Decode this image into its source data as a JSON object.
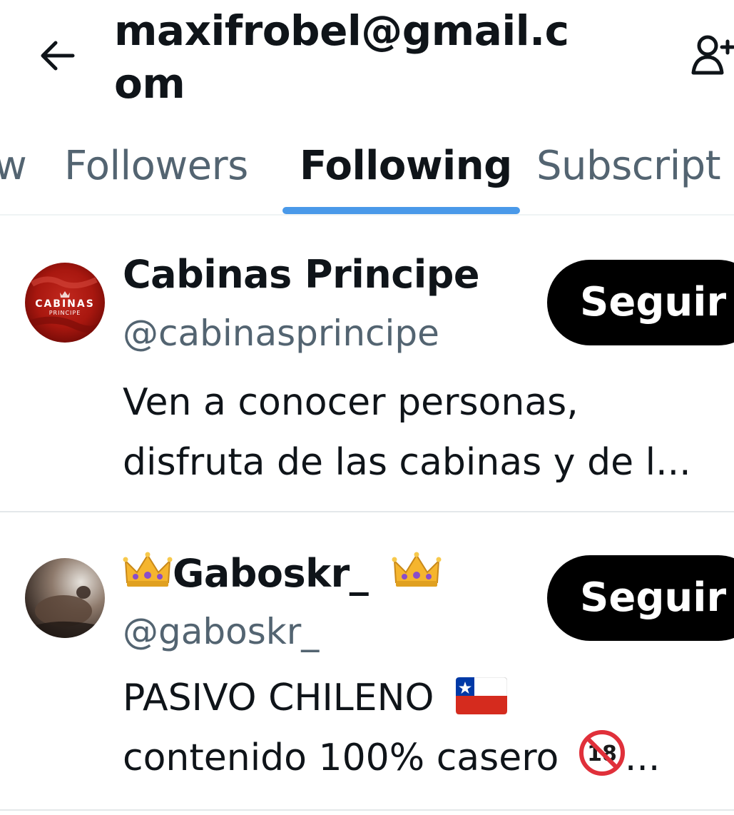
{
  "header": {
    "title": "maxifrobel@gmail.com"
  },
  "tabs": [
    {
      "label": "w",
      "active": false
    },
    {
      "label": "Followers",
      "active": false
    },
    {
      "label": "Following",
      "active": true
    },
    {
      "label": "Subscript",
      "active": false
    }
  ],
  "users": [
    {
      "name": "Cabinas Principe",
      "handle": "@cabinasprincipe",
      "bio_line1": "Ven a conocer personas,",
      "bio_line2": "disfruta de las cabinas y de l...",
      "follow_label": "Seguir",
      "avatar_text": "CABINAS",
      "avatar_subtext": "PRINCIPE"
    },
    {
      "name": "Gaboskr_",
      "name_emoji": "crown",
      "handle": "@gaboskr_",
      "bio_line1": "PASIVO CHILENO",
      "bio_line1_emoji": "chile-flag",
      "bio_line2": "contenido 100% casero",
      "bio_line2_emoji": "no-under-18",
      "bio_line2_suffix": "...",
      "follow_label": "Seguir"
    }
  ],
  "colors": {
    "accent": "#4a99e9",
    "secondary_text": "#536471",
    "button_bg": "#000000"
  }
}
